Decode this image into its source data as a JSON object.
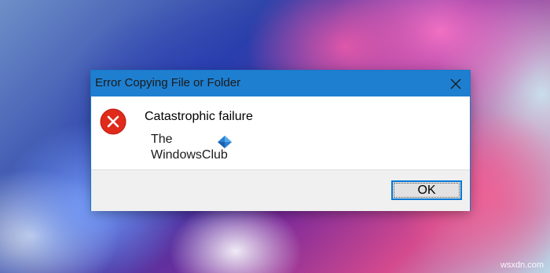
{
  "dialog": {
    "title": "Error Copying File or Folder",
    "message": "Catastrophic failure",
    "icon": "error-icon",
    "ok_label": "OK",
    "close_icon": "close-icon"
  },
  "watermark": {
    "line1": "The",
    "line2": "WindowsClub",
    "logo_icon": "windowsclub-logo-icon"
  },
  "site_mark": "wsxdn.com",
  "colors": {
    "titlebar": "#1e7fd0",
    "error_red": "#e02a1a",
    "ok_border": "#0078d7",
    "footer_bg": "#f0f0f0"
  }
}
